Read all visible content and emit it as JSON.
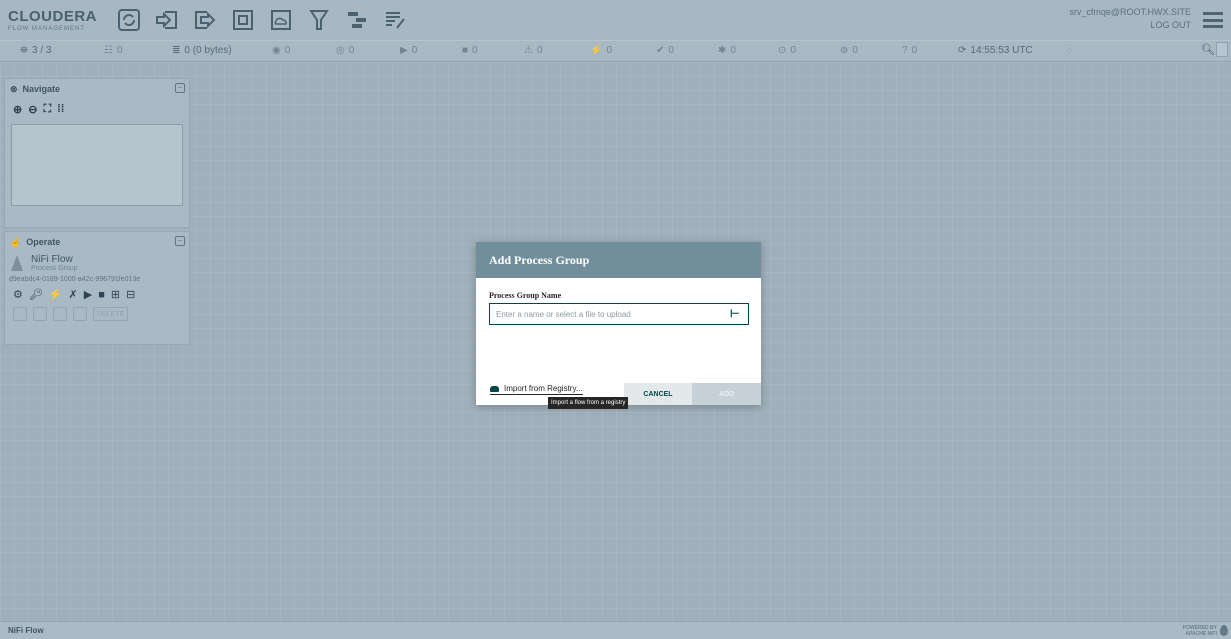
{
  "header": {
    "logo_main": "CLOUDERA",
    "logo_sub": "FLOW MANAGEMENT",
    "user": "srv_cfmqe@ROOT.HWX.SITE",
    "logout": "LOG OUT",
    "components": [
      "processor-icon",
      "input-port-icon",
      "output-port-icon",
      "process-group-icon",
      "remote-process-group-icon",
      "funnel-icon",
      "template-icon",
      "label-icon"
    ]
  },
  "status": {
    "clusters": "3 / 3",
    "threads": "0",
    "queued": "0 (0 bytes)",
    "transmitting": "0",
    "not_transmitting": "0",
    "running": "0",
    "stopped": "0",
    "invalid": "0",
    "disabled": "0",
    "up_to_date": "0",
    "locally_modified": "0",
    "stale": "0",
    "locally_modified_stale": "0",
    "sync_failure": "0",
    "time": "14:55:53 UTC"
  },
  "navigate": {
    "title": "Navigate"
  },
  "operate": {
    "title": "Operate",
    "name": "NiFi Flow",
    "type": "Process Group",
    "id": "d9eabdc4-0189-1000-a42c-996791fe013e",
    "delete_label": "DELETE"
  },
  "dialog": {
    "title": "Add Process Group",
    "field_label": "Process Group Name",
    "placeholder": "Enter a name or select a file to upload",
    "import_link": "Import from Registry...",
    "cancel": "CANCEL",
    "add": "ADD",
    "tooltip": "Import a flow from a registry"
  },
  "footer": {
    "breadcrumb": "NiFi Flow",
    "powered_1": "POWERED BY",
    "powered_2": "APACHE NIFI"
  }
}
